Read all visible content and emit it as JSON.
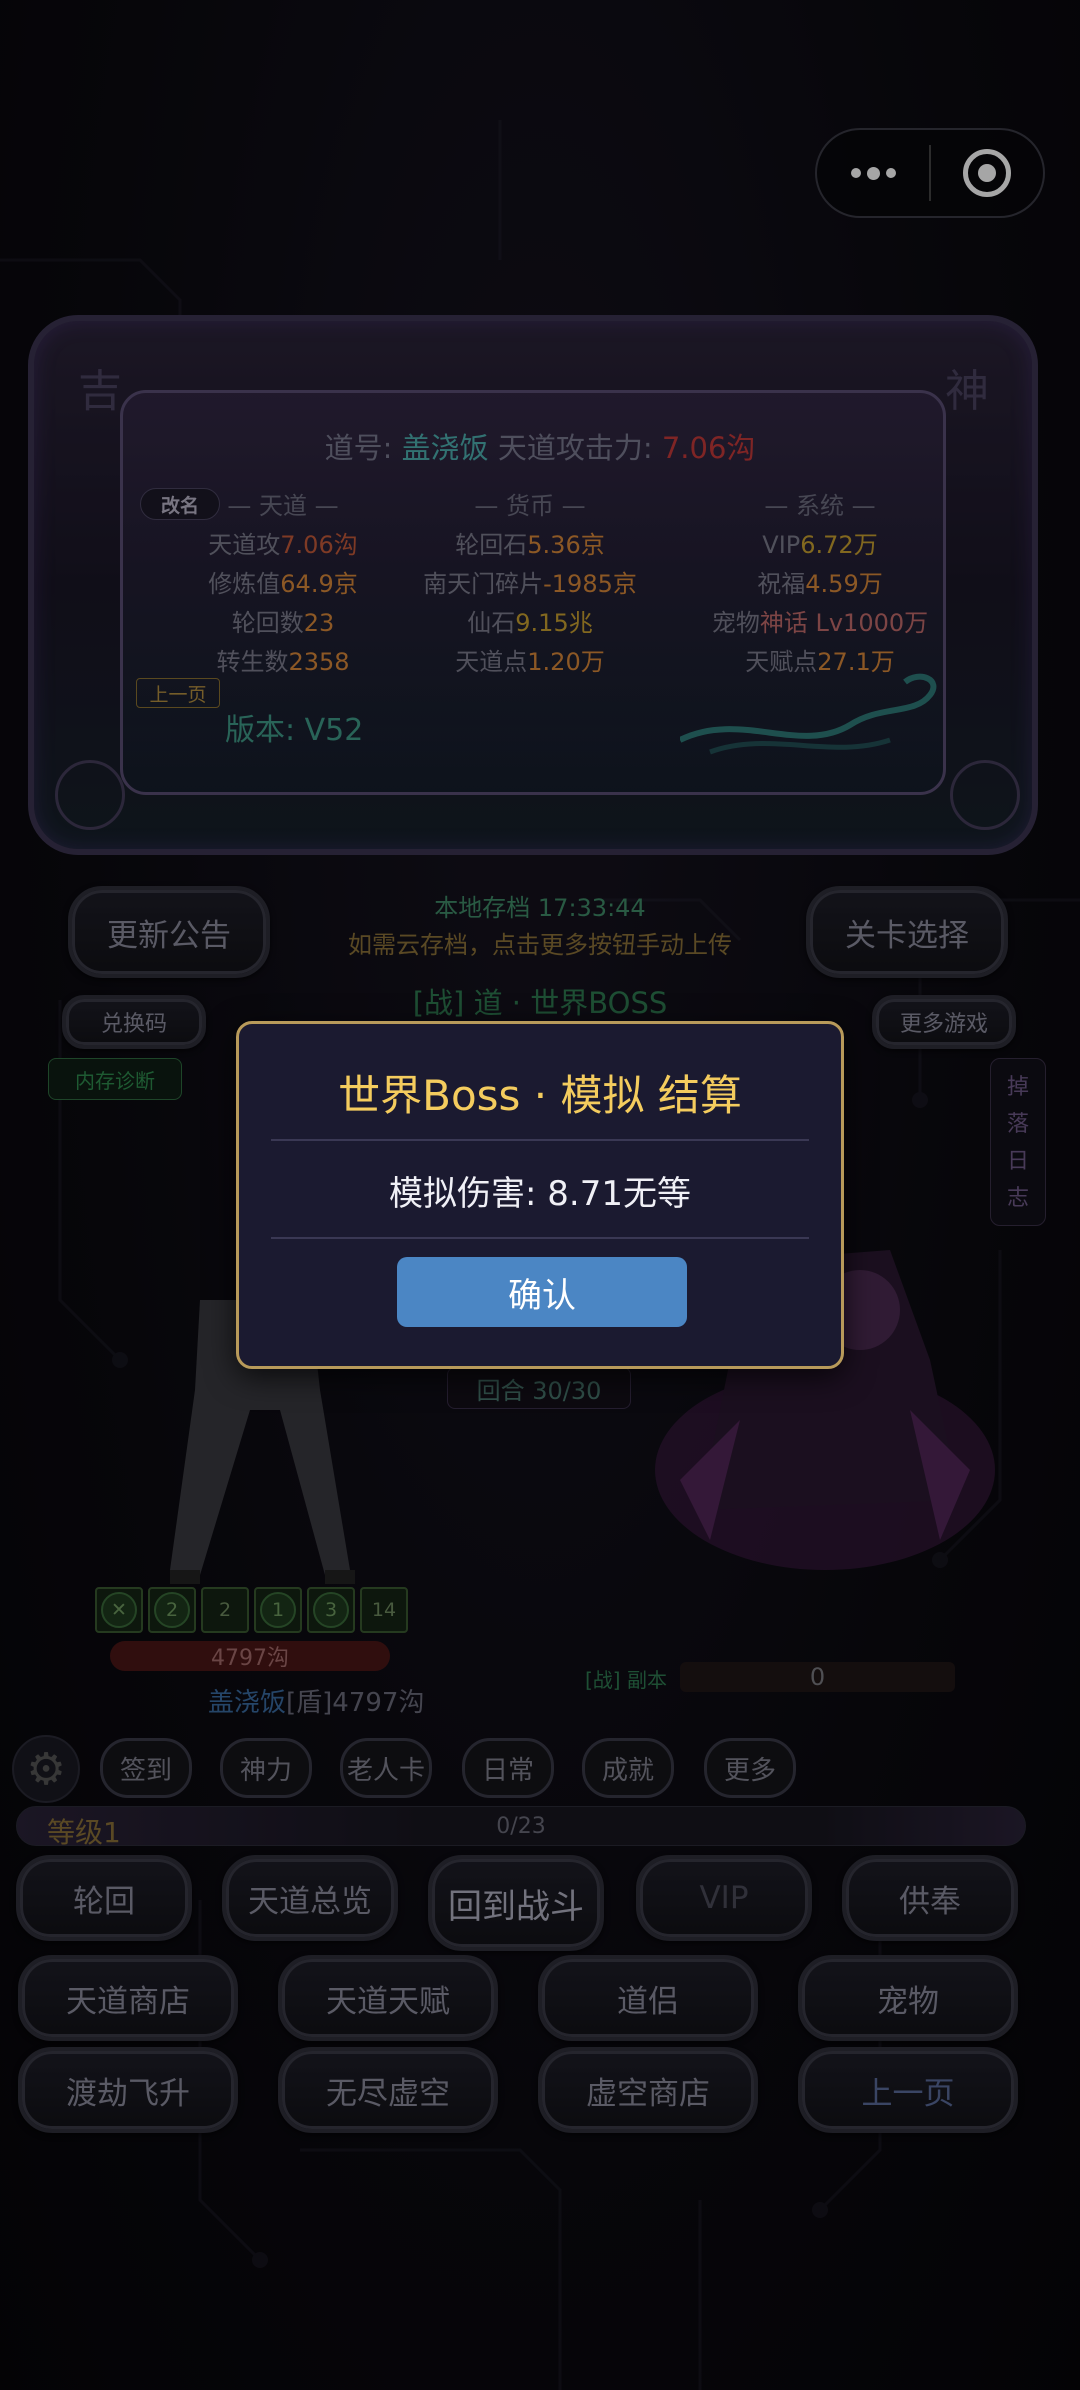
{
  "capsule": {
    "menu_icon": "more-dots-icon",
    "close_icon": "target-icon"
  },
  "panel": {
    "corner_left": "吉",
    "corner_right": "神",
    "header_prefix": "道号:",
    "player_name": "盖浇饭",
    "atk_label": "天道攻击力:",
    "atk_value": "7.06沟",
    "rename": "改名",
    "col1": {
      "title": "— 天道 —",
      "rows": [
        {
          "label": "天道攻",
          "value": "7.06沟"
        },
        {
          "label": "修炼值",
          "value": "64.9京"
        },
        {
          "label": "轮回数",
          "value": "23"
        },
        {
          "label": "转生数",
          "value": "2358"
        }
      ]
    },
    "col2": {
      "title": "— 货币 —",
      "rows": [
        {
          "label": "轮回石",
          "value": "5.36京"
        },
        {
          "label": "南天门碎片",
          "value": "-1985京"
        },
        {
          "label": "仙石",
          "value": "9.15兆"
        },
        {
          "label": "天道点",
          "value": "1.20万"
        }
      ]
    },
    "col3": {
      "title": "— 系统 —",
      "rows": [
        {
          "label": "VIP",
          "value": "6.72万"
        },
        {
          "label": "祝福",
          "value": "4.59万"
        },
        {
          "label": "宠物",
          "value": "神话 Lv1000万"
        },
        {
          "label": "天赋点",
          "value": "27.1万"
        }
      ]
    },
    "prev_page": "上一页",
    "version": "版本:  V52"
  },
  "top_buttons": {
    "announce": "更新公告",
    "stage_select": "关卡选择",
    "redeem": "兑换码",
    "more_games": "更多游戏",
    "mem_diag": "内存诊断",
    "drop_log": [
      "掉",
      "落",
      "日",
      "志"
    ]
  },
  "save": {
    "local": "本地存档   17:33:44",
    "hint": "如需云存档，点击更多按钮手动上传",
    "battle_title": "[战] 道 · 世界BOSS"
  },
  "battle": {
    "round": "回合 30/30",
    "buffs": [
      "2",
      "2",
      "1",
      "3",
      "14"
    ],
    "hp": "4797沟",
    "hero_name": "盖浇饭",
    "hero_suffix": "[盾]4797沟",
    "boss_tag": "[战] 副本",
    "boss_hp": "0"
  },
  "actions": {
    "sign": "签到",
    "power": "神力",
    "elder_card": "老人卡",
    "daily": "日常",
    "achieve": "成就",
    "more": "更多"
  },
  "level": {
    "label": "等级1",
    "xp": "0/23"
  },
  "menu": {
    "row1": [
      "轮回",
      "天道总览",
      "回到战斗",
      "VIP",
      "供奉"
    ],
    "row2": [
      "天道商店",
      "天道天赋",
      "道侣",
      "宠物"
    ],
    "row3": [
      "渡劫飞升",
      "无尽虚空",
      "虚空商店",
      "上一页"
    ]
  },
  "modal": {
    "title": "世界Boss · 模拟 结算",
    "damage": "模拟伤害: 8.71无等",
    "confirm": "确认"
  },
  "colors": {
    "accent_gold": "#f4cc5e",
    "confirm_blue": "#4b86c4",
    "modal_bg": "#1b1a30"
  }
}
